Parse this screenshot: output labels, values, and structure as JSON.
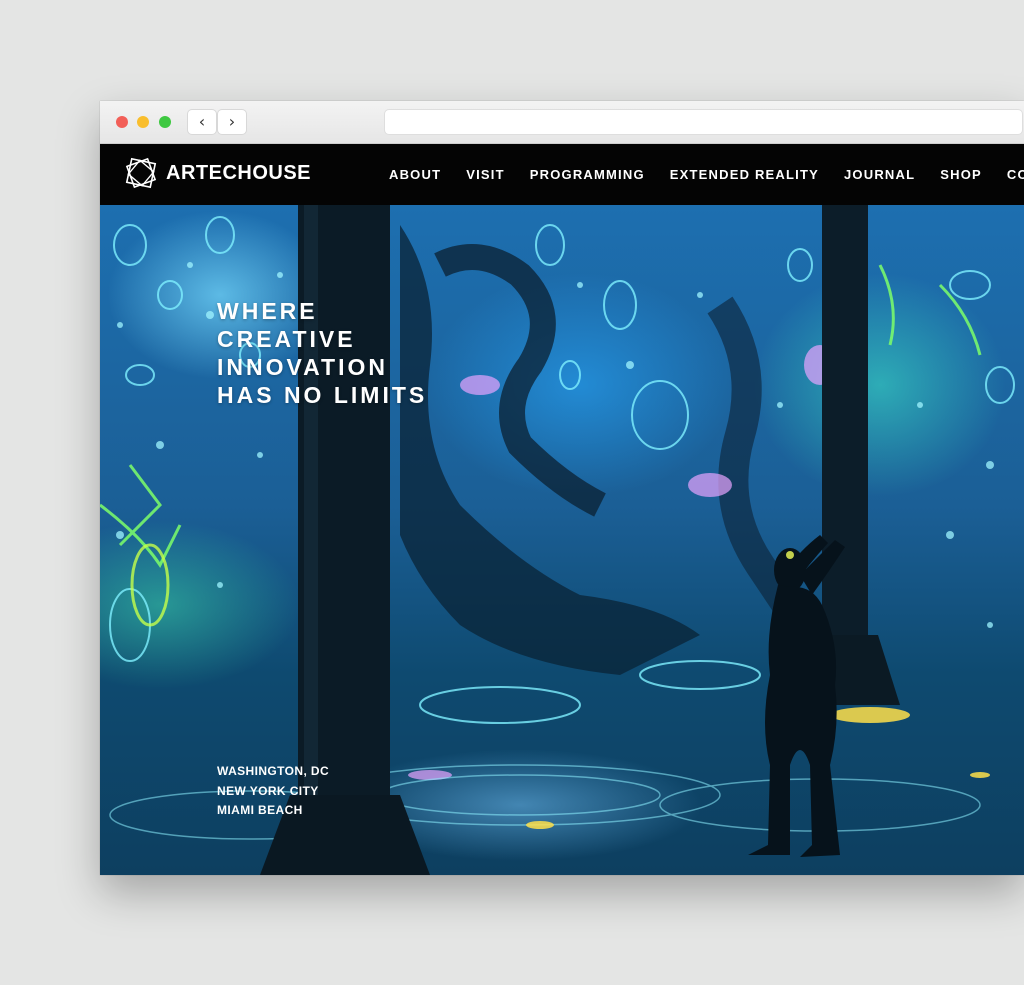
{
  "browser": {
    "back_glyph": "‹",
    "forward_glyph": "›"
  },
  "site": {
    "brand": "ARTECHOUSE",
    "nav": [
      "ABOUT",
      "VISIT",
      "PROGRAMMING",
      "EXTENDED REALITY",
      "JOURNAL",
      "SHOP",
      "CONT"
    ]
  },
  "hero": {
    "tagline_lines": [
      "WHERE",
      "CREATIVE",
      "INNOVATION",
      "HAS NO LIMITS"
    ],
    "locations": [
      "WASHINGTON, DC",
      "NEW YORK CITY",
      "MIAMI BEACH"
    ]
  },
  "colors": {
    "page_bg": "#e4e5e4",
    "header_bg": "#040404",
    "accent_cyan": "#5fe6ff",
    "accent_green": "#7dff6a"
  }
}
